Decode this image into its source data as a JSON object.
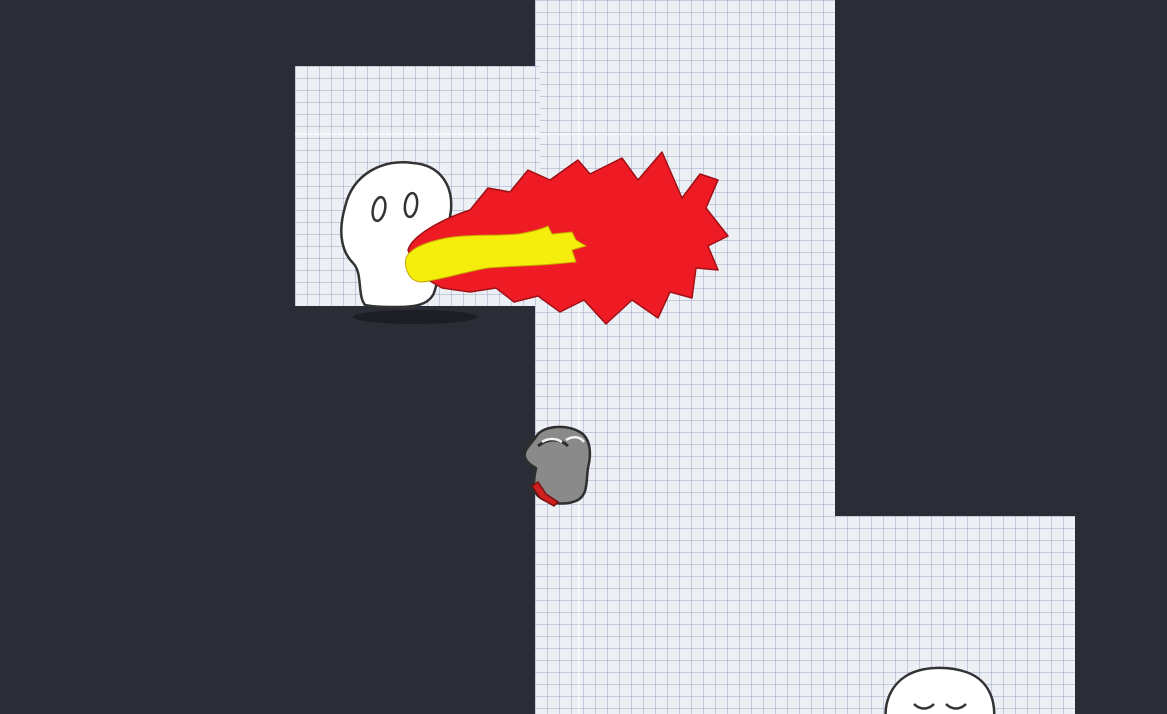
{
  "scene": {
    "background_color": "#2a2d35",
    "floor_color": "#ecf0f5",
    "grid_line_color": "#7887af"
  },
  "entities": {
    "ghost_enemy": {
      "icon": "ghost-icon",
      "state": "breathing-fire"
    },
    "fire_breath": {
      "icon": "fire-icon",
      "outer_color": "#ee1b24",
      "inner_color": "#f5ee0c"
    },
    "player": {
      "icon": "penguin-player-icon",
      "body_color": "#8a8a8a",
      "scarf_color": "#d01f1f"
    },
    "sleeping_ghost": {
      "icon": "sleeping-ghost-icon",
      "state": "sleeping"
    }
  }
}
